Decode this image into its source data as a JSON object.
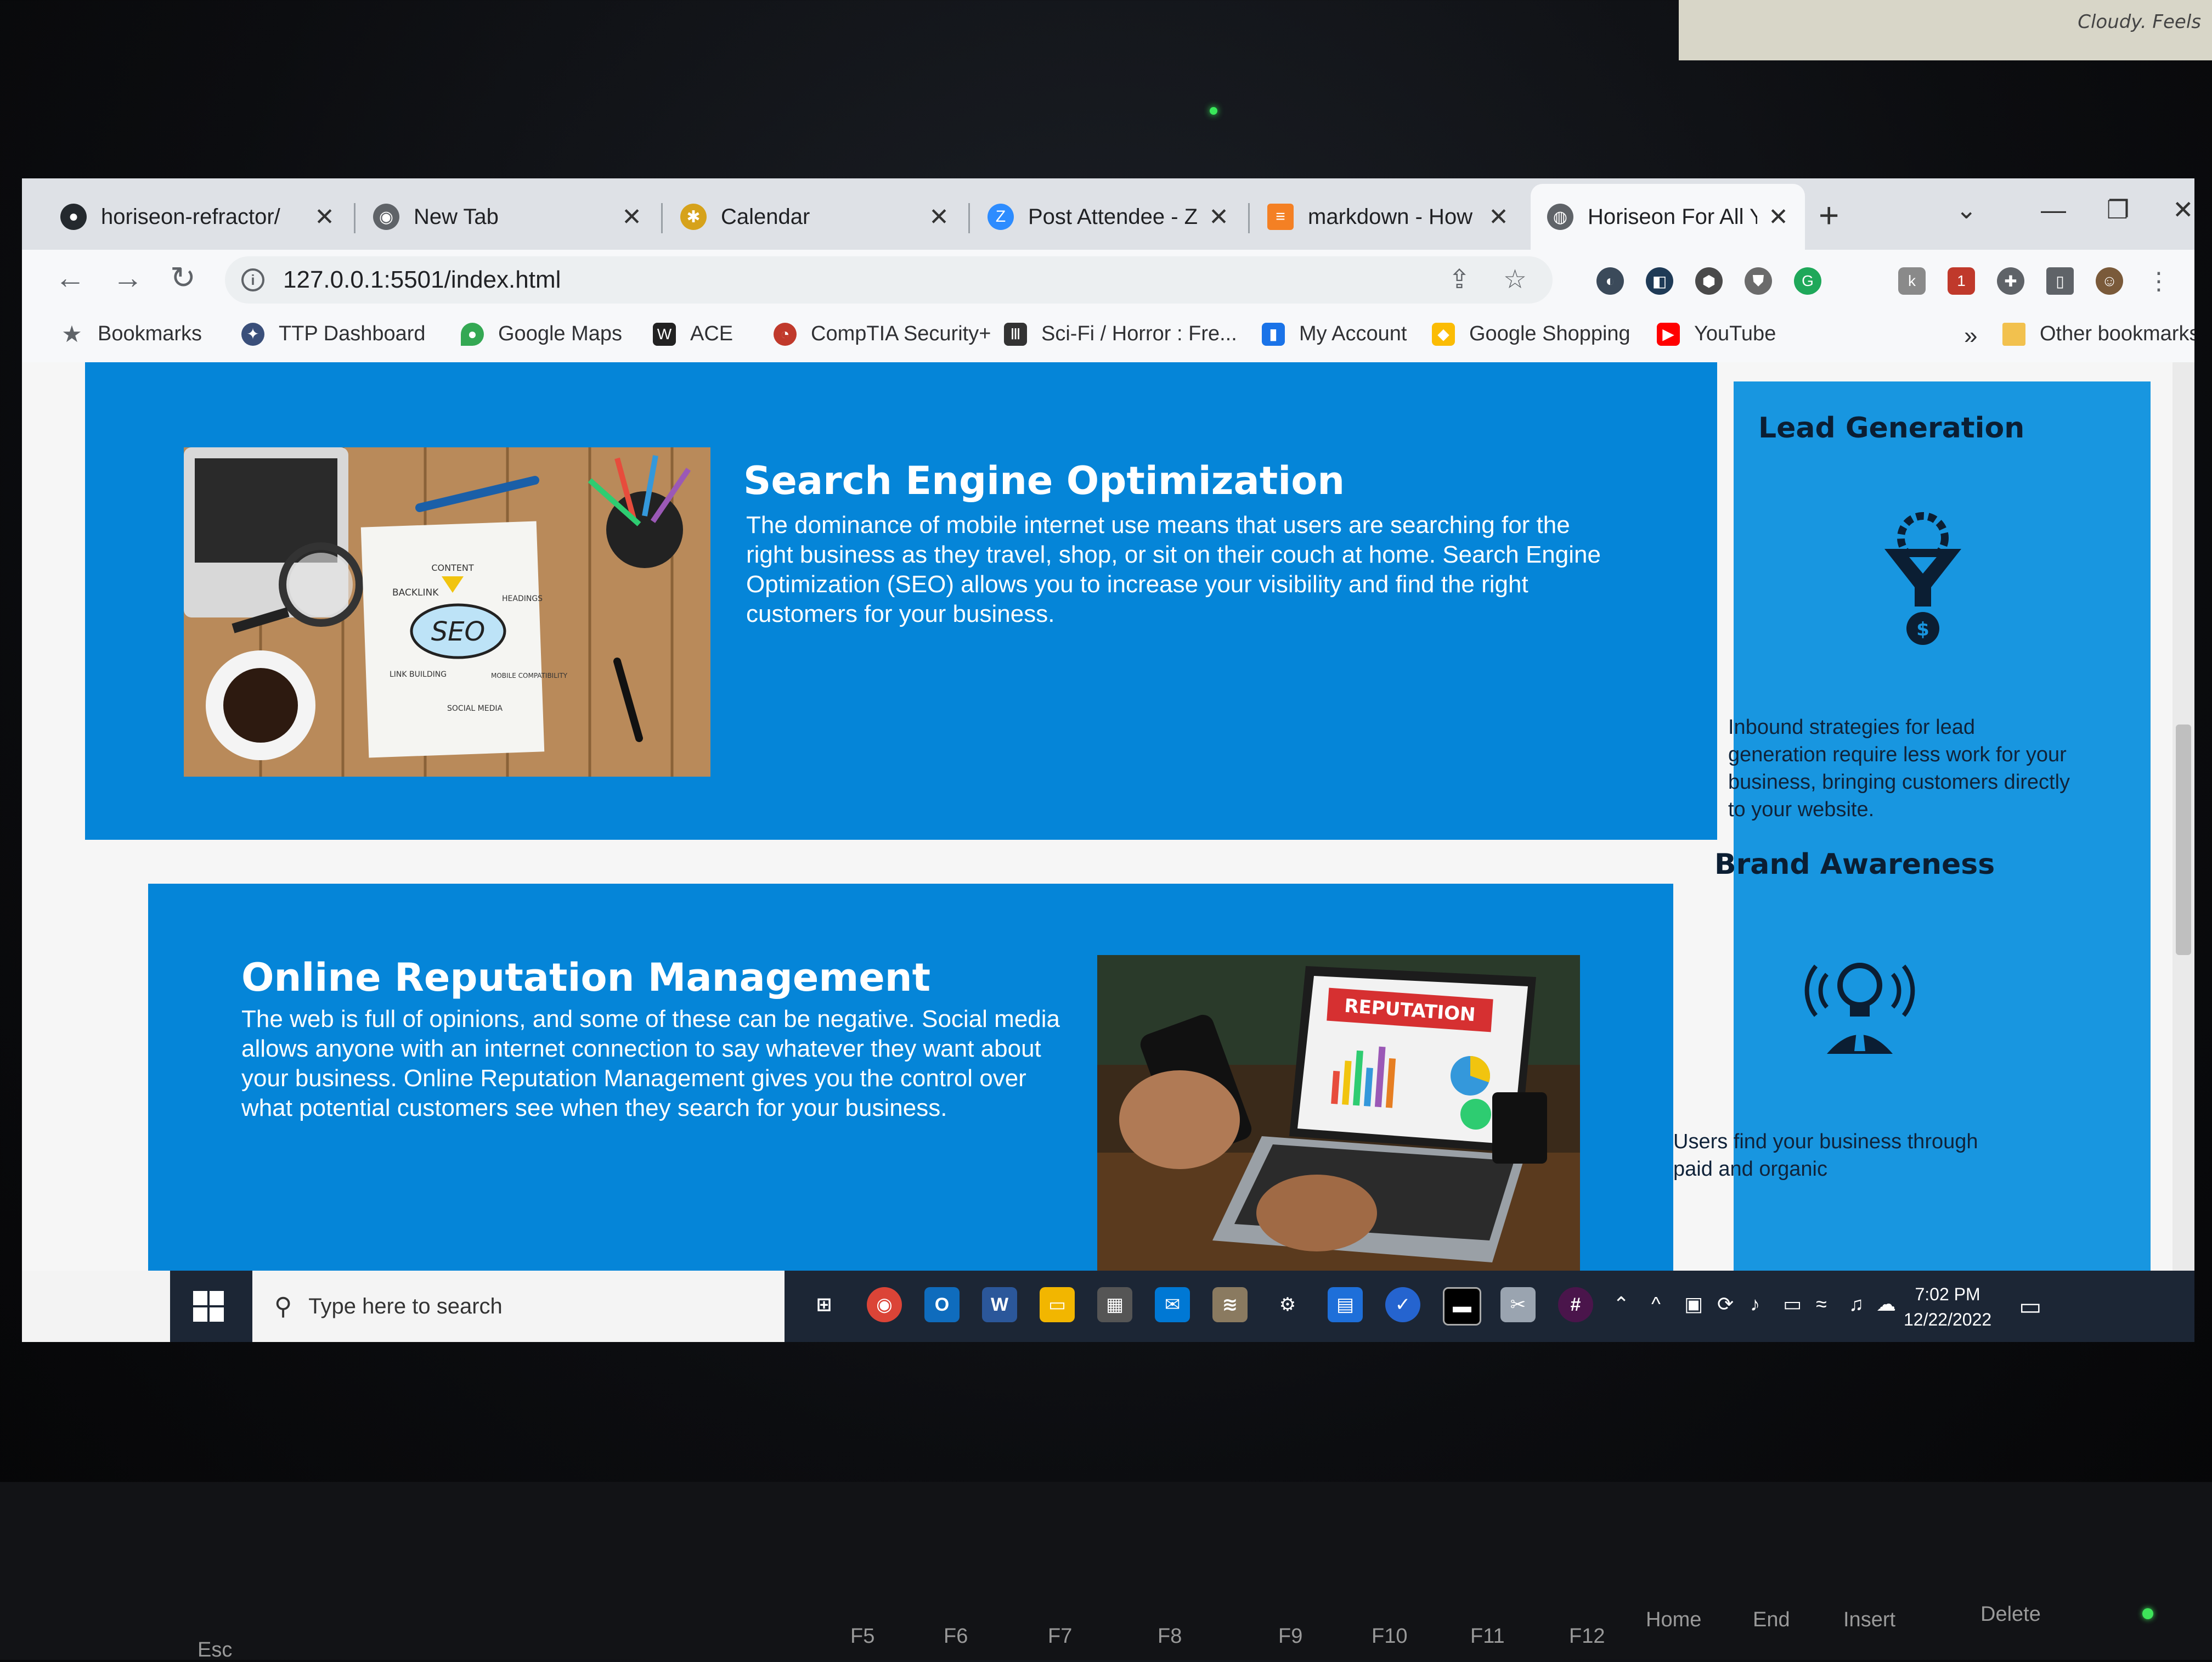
{
  "desk_note": "Cloudy. Feels",
  "browser": {
    "tabs": [
      {
        "label": "horiseon-refractor/",
        "icon": "github-icon"
      },
      {
        "label": "New Tab",
        "icon": "chrome-icon"
      },
      {
        "label": "Calendar",
        "icon": "bee-icon"
      },
      {
        "label": "Post Attendee - Zo",
        "icon": "zoom-icon"
      },
      {
        "label": "markdown - How to",
        "icon": "stackoverflow-icon"
      },
      {
        "label": "Horiseon For All Yo",
        "icon": "globe-icon"
      }
    ],
    "url": "127.0.0.1:5501/index.html",
    "bookmarks": [
      {
        "label": "Bookmarks",
        "icon": "star-icon"
      },
      {
        "label": "TTP Dashboard",
        "icon": "seal-icon"
      },
      {
        "label": "Google Maps",
        "icon": "maps-pin-icon"
      },
      {
        "label": "ACE",
        "icon": "w-icon"
      },
      {
        "label": "CompTIA Security+",
        "icon": "pie-icon"
      },
      {
        "label": "Sci-Fi / Horror : Fre...",
        "icon": "library-icon"
      },
      {
        "label": "My Account",
        "icon": "book-icon"
      },
      {
        "label": "Google Shopping",
        "icon": "shopping-tag-icon"
      },
      {
        "label": "YouTube",
        "icon": "youtube-icon"
      }
    ],
    "more_bookmarks": "»",
    "other_bookmarks": "Other bookmarks"
  },
  "page": {
    "seo": {
      "title": "Search Engine Optimization",
      "body": "The dominance of mobile internet use means that users are searching for the right business as they travel, shop, or sit on their couch at home. Search Engine Optimization (SEO) allows you to increase your visibility and find the right customers for your business.",
      "photo_words": {
        "seo": "SEO",
        "content": "CONTENT",
        "backlink": "BACKLINK",
        "headings": "HEADINGS",
        "link_building": "LINK BUILDING",
        "mobile": "MOBILE COMPATIBILITY",
        "social": "SOCIAL MEDIA"
      }
    },
    "orm": {
      "title": "Online Reputation Management",
      "body": "The web is full of opinions, and some of these can be negative. Social media allows anyone with an internet connection to say whatever they want about your business. Online Reputation Management gives you the control over what potential customers see when they search for your business.",
      "photo_banner": "REPUTATION"
    },
    "aside": {
      "lead_title": "Lead Generation",
      "lead_body": "Inbound strategies for lead generation require less work for your business, bringing customers directly to your website.",
      "brand_title": "Brand Awareness",
      "brand_body": "Users find your business through paid and organic"
    }
  },
  "taskbar": {
    "search_placeholder": "Type here to search",
    "time": "7:02 PM",
    "date": "12/22/2022"
  },
  "keyboard": [
    "Esc",
    "F5",
    "F6",
    "F7",
    "F8",
    "F9",
    "F10",
    "F11",
    "F12",
    "Home",
    "End",
    "Insert",
    "Delete"
  ]
}
